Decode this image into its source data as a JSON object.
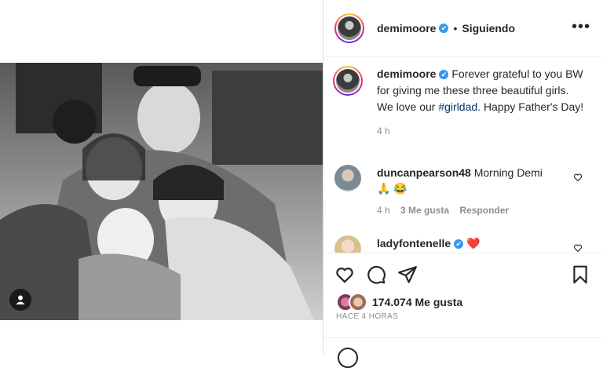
{
  "post": {
    "username": "demimoore",
    "verified_mark": "✔",
    "separator": "•",
    "follow_status": "Siguiendo",
    "more_label": "•••"
  },
  "caption": {
    "username": "demimoore",
    "text_before_tag": "Forever grateful to you BW for giving me these three beautiful girls. We love our",
    "hashtag": "#girldad",
    "text_after_tag": ". Happy Father's Day!",
    "time": "4 h"
  },
  "comments": [
    {
      "username": "duncanpearson48",
      "text": "Morning Demi",
      "emoji": "🙏 😂",
      "time": "4 h",
      "likes": "3 Me gusta",
      "reply": "Responder"
    },
    {
      "username": "ladyfontenelle",
      "verified_mark": "✔",
      "text": "❤️"
    }
  ],
  "actions": {
    "likes_count": "174.074 Me gusta",
    "posted_ago": "HACE 4 HORAS"
  },
  "colors": {
    "accent_link": "#00376b",
    "verified": "#3897f0",
    "muted": "#8e8e8e"
  },
  "icons": [
    "user-tag-icon",
    "like-icon",
    "comment-icon",
    "share-icon",
    "save-icon",
    "more-icon",
    "heart-icon"
  ]
}
